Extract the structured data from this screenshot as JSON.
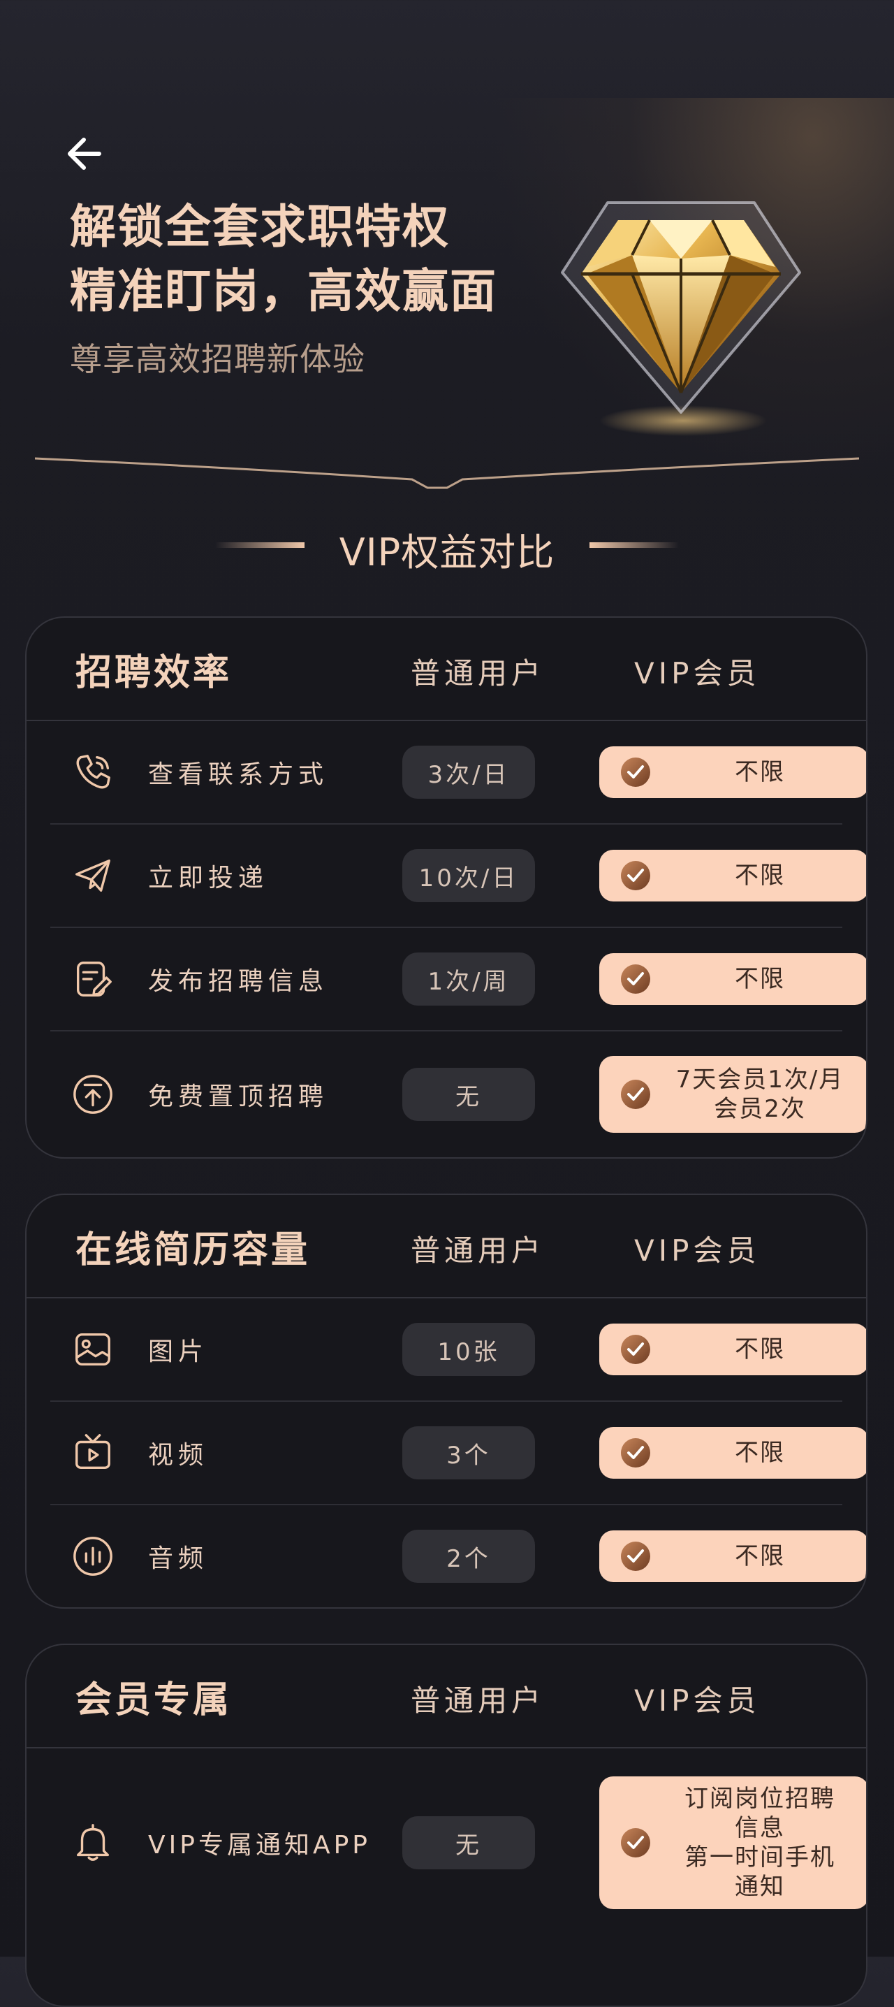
{
  "header": {
    "title_line1": "解锁全套求职特权",
    "title_line2": "精准盯岗，高效赢面",
    "subtitle": "尊享高效招聘新体验"
  },
  "section_title": "VIP权益对比",
  "colors": {
    "accent": "#fcd3bb",
    "title": "#f4d3bb",
    "background": "#1c1c23",
    "pill": "#303036"
  },
  "cards": [
    {
      "title": "招聘效率",
      "col_normal": "普通用户",
      "col_vip": "VIP会员",
      "rows": [
        {
          "icon": "phone-icon",
          "label": "查看联系方式",
          "normal": "3次/日",
          "vip": "不限"
        },
        {
          "icon": "send-icon",
          "label": "立即投递",
          "normal": "10次/日",
          "vip": "不限"
        },
        {
          "icon": "edit-document-icon",
          "label": "发布招聘信息",
          "normal": "1次/周",
          "vip": "不限"
        },
        {
          "icon": "pin-top-icon",
          "label": "免费置顶招聘",
          "normal": "无",
          "vip": "7天会员1次/月\n会员2次"
        }
      ]
    },
    {
      "title": "在线简历容量",
      "col_normal": "普通用户",
      "col_vip": "VIP会员",
      "rows": [
        {
          "icon": "image-icon",
          "label": "图片",
          "normal": "10张",
          "vip": "不限"
        },
        {
          "icon": "video-icon",
          "label": "视频",
          "normal": "3个",
          "vip": "不限"
        },
        {
          "icon": "audio-icon",
          "label": "音频",
          "normal": "2个",
          "vip": "不限"
        }
      ]
    },
    {
      "title": "会员专属",
      "col_normal": "普通用户",
      "col_vip": "VIP会员",
      "rows": [
        {
          "icon": "bell-icon",
          "label": "VIP专属通知APP",
          "normal": "无",
          "vip": "订阅岗位招聘\n信息\n第一时间手机\n通知"
        }
      ]
    }
  ]
}
